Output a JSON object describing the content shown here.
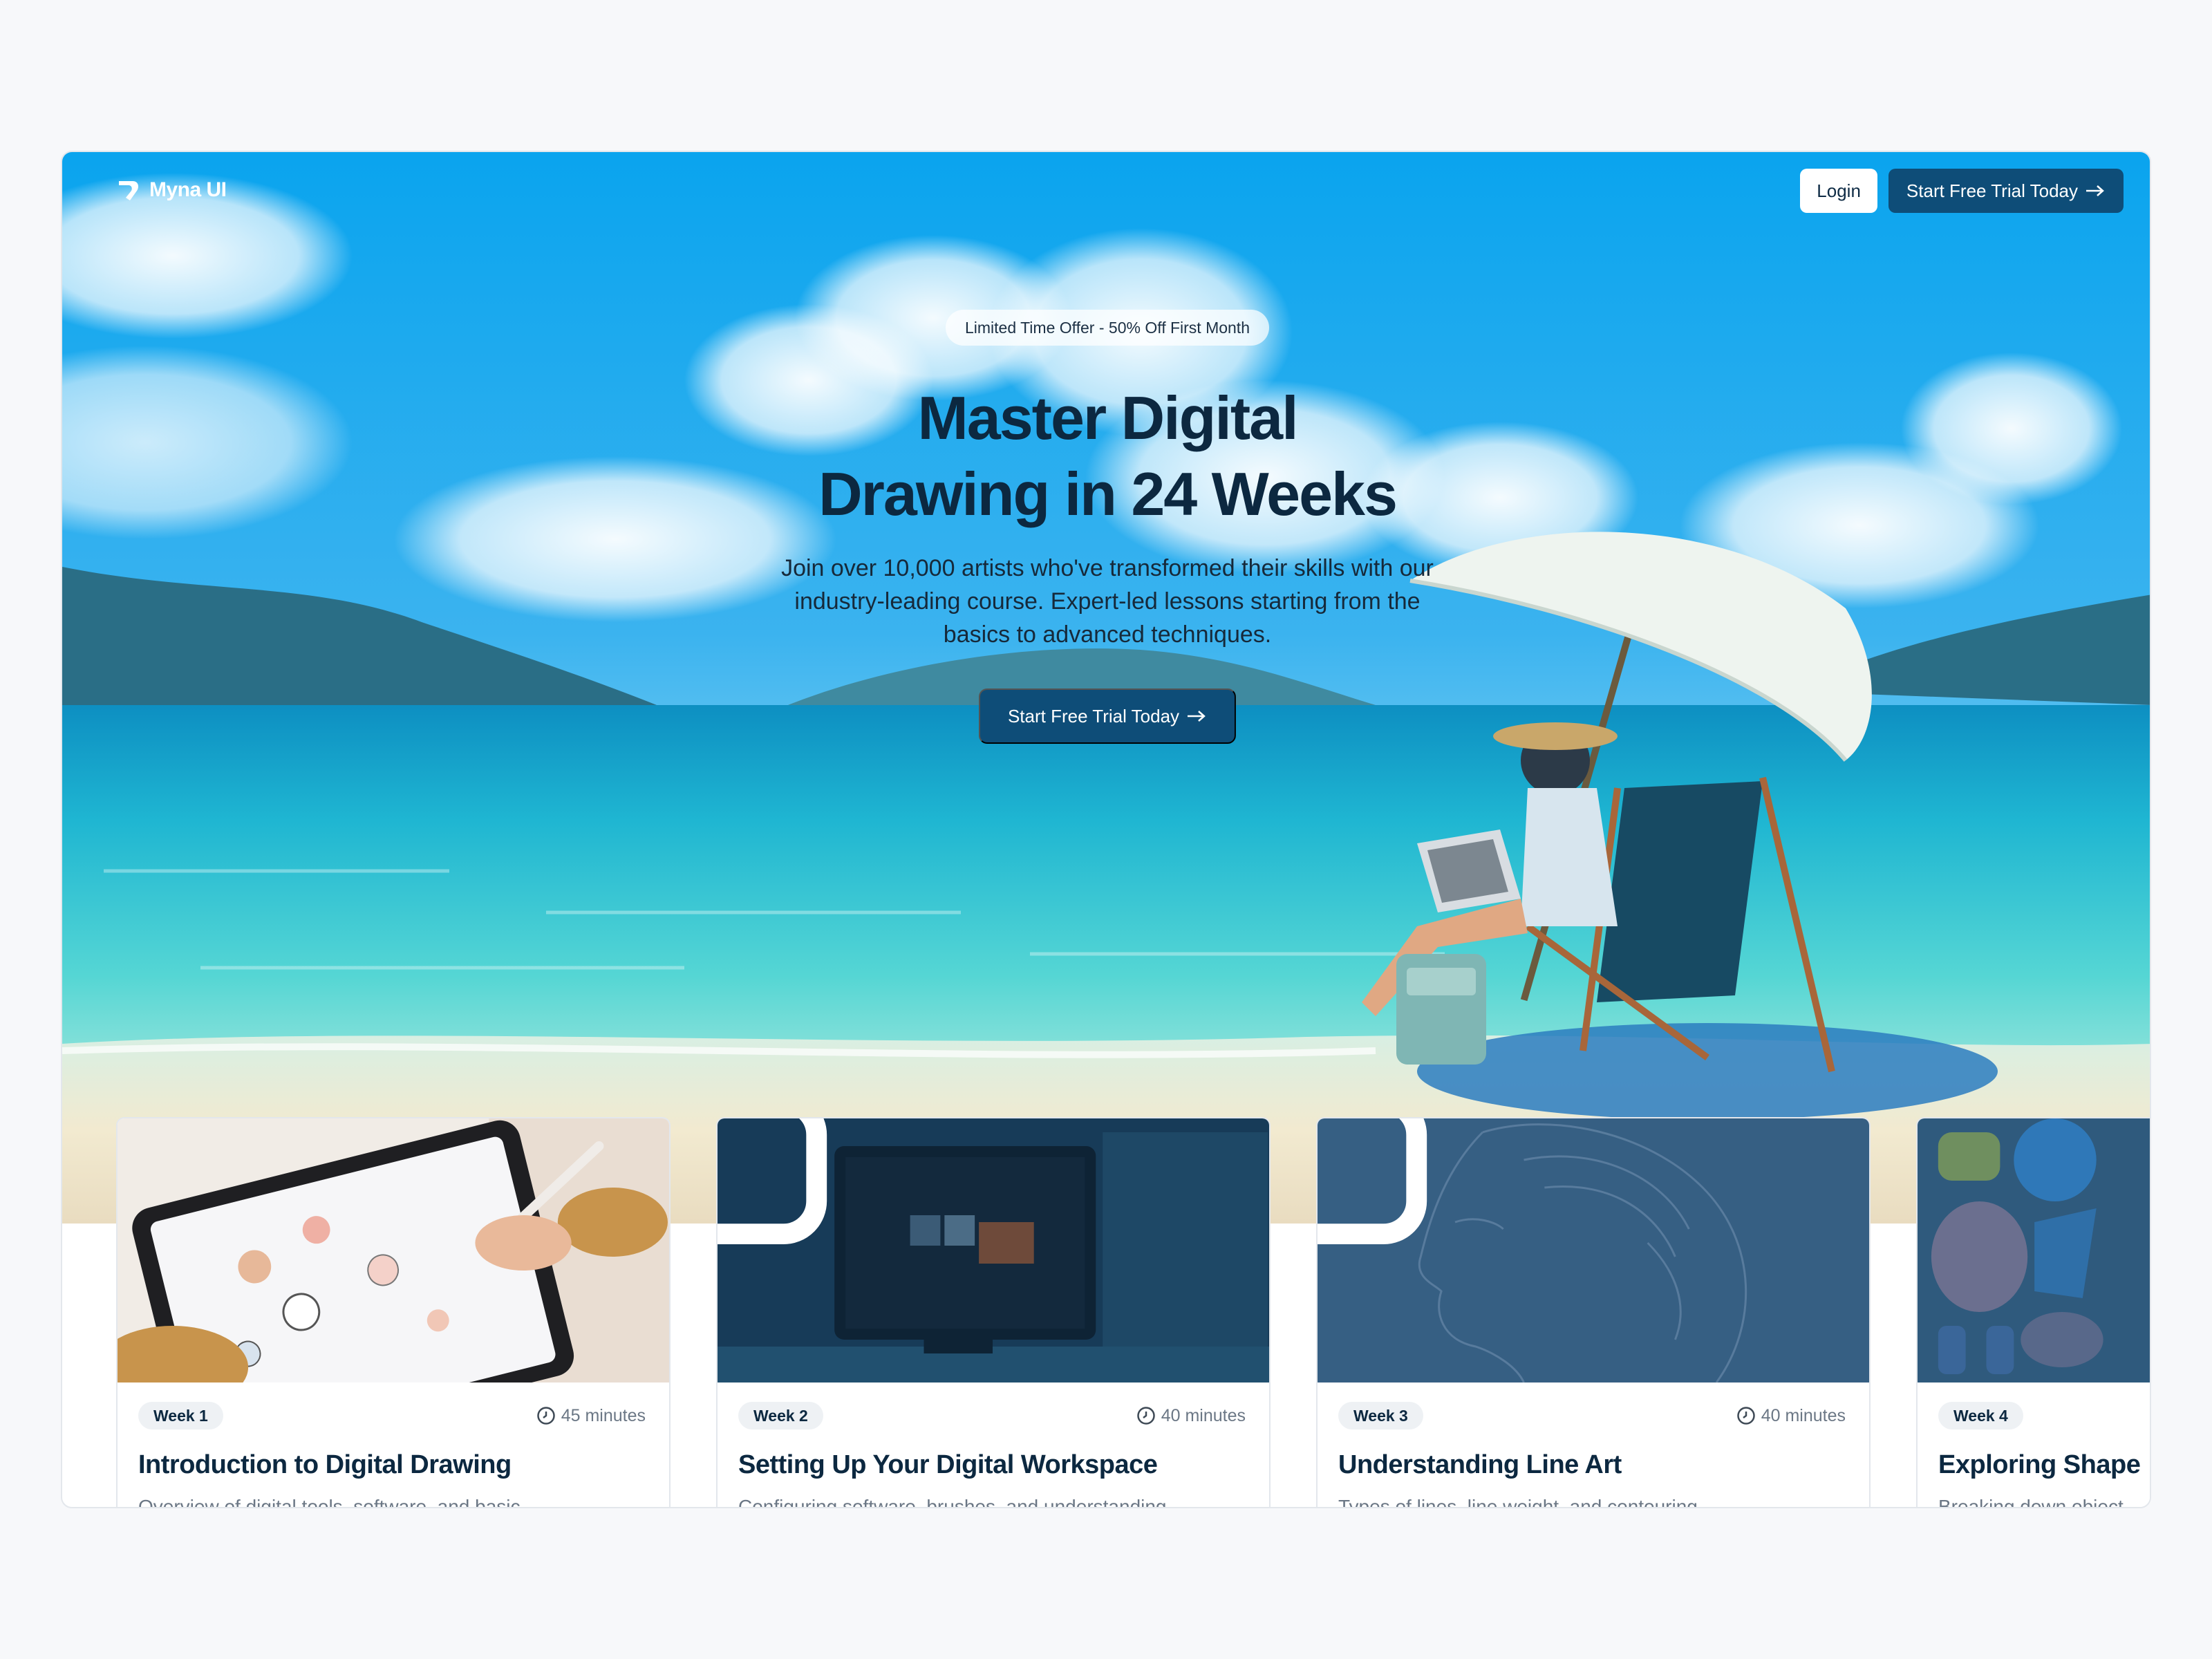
{
  "brand": {
    "name": "Myna UI"
  },
  "nav": {
    "login_label": "Login",
    "trial_label": "Start Free Trial Today"
  },
  "hero": {
    "badge": "Limited Time Offer - 50% Off First Month",
    "title_line1": "Master Digital",
    "title_line2": "Drawing in 24 Weeks",
    "subtitle": "Join over 10,000 artists who've transformed their skills with our industry-leading course. Expert-led lessons starting from the basics to advanced techniques.",
    "cta_label": "Start Free Trial Today"
  },
  "cards": [
    {
      "week": "Week 1",
      "duration": "45 minutes",
      "title": "Introduction to Digital Drawing",
      "description": "Overview of digital tools, software, and basic",
      "locked": false
    },
    {
      "week": "Week 2",
      "duration": "40 minutes",
      "title": "Setting Up Your Digital Workspace",
      "description": "Configuring software, brushes, and understanding",
      "locked": true
    },
    {
      "week": "Week 3",
      "duration": "40 minutes",
      "title": "Understanding Line Art",
      "description": "Types of lines, line weight, and contouring",
      "locked": true
    },
    {
      "week": "Week 4",
      "duration": "",
      "title": "Exploring Shape",
      "description": "Breaking down object",
      "locked": false
    }
  ],
  "colors": {
    "primary": "#0e4d78",
    "heading": "#0c2840",
    "sky": "#1ea3e6",
    "sea": "#27c1cf"
  }
}
